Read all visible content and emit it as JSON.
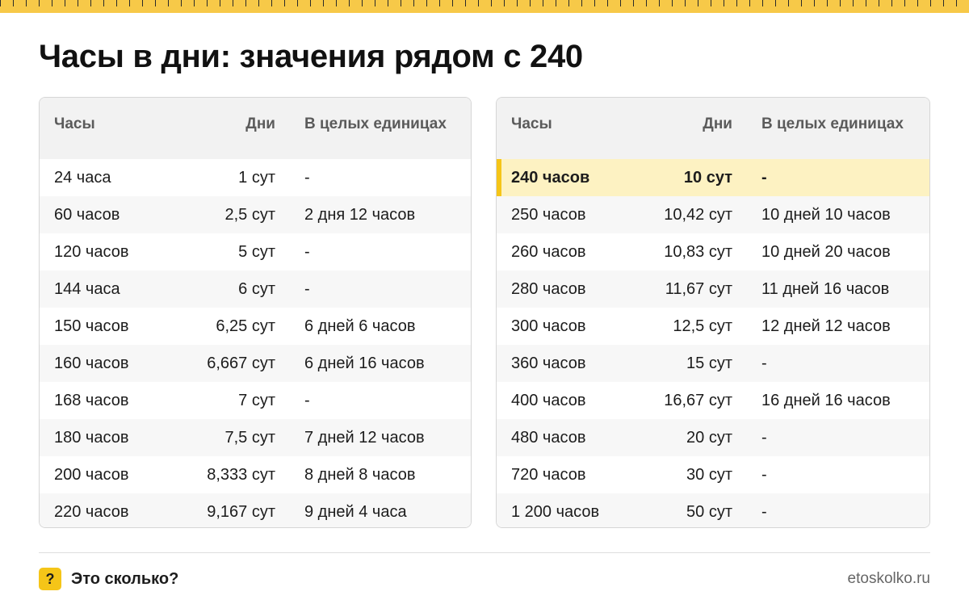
{
  "title": "Часы в дни: значения рядом с 240",
  "table_left": {
    "headers": [
      "Часы",
      "Дни",
      "В целых единицах"
    ],
    "rows": [
      [
        "24 часа",
        "1 сут",
        "-"
      ],
      [
        "60 часов",
        "2,5 сут",
        "2 дня 12 часов"
      ],
      [
        "120 часов",
        "5 сут",
        "-"
      ],
      [
        "144 часа",
        "6 сут",
        "-"
      ],
      [
        "150 часов",
        "6,25 сут",
        "6 дней 6 часов"
      ],
      [
        "160 часов",
        "6,667 сут",
        "6 дней 16 часов"
      ],
      [
        "168 часов",
        "7 сут",
        "-"
      ],
      [
        "180 часов",
        "7,5 сут",
        "7 дней 12 часов"
      ],
      [
        "200 часов",
        "8,333 сут",
        "8 дней 8 часов"
      ],
      [
        "220 часов",
        "9,167 сут",
        "9 дней 4 часа"
      ]
    ]
  },
  "table_right": {
    "headers": [
      "Часы",
      "Дни",
      "В целых единицах"
    ],
    "rows": [
      [
        "240 часов",
        "10 сут",
        "-"
      ],
      [
        "250 часов",
        "10,42 сут",
        "10 дней 10 часов"
      ],
      [
        "260 часов",
        "10,83 сут",
        "10 дней 20 часов"
      ],
      [
        "280 часов",
        "11,67 сут",
        "11 дней 16 часов"
      ],
      [
        "300 часов",
        "12,5 сут",
        "12 дней 12 часов"
      ],
      [
        "360 часов",
        "15 сут",
        "-"
      ],
      [
        "400 часов",
        "16,67 сут",
        "16 дней 16 часов"
      ],
      [
        "480 часов",
        "20 сут",
        "-"
      ],
      [
        "720 часов",
        "30 сут",
        "-"
      ],
      [
        "1 200 часов",
        "50 сут",
        "-"
      ]
    ],
    "highlighted_row": 0
  },
  "footer": {
    "badge": "?",
    "brand": "Это сколько?",
    "site": "etoskolko.ru"
  },
  "colors": {
    "accent": "#f5c518",
    "highlight_row": "#fdf2c2"
  }
}
